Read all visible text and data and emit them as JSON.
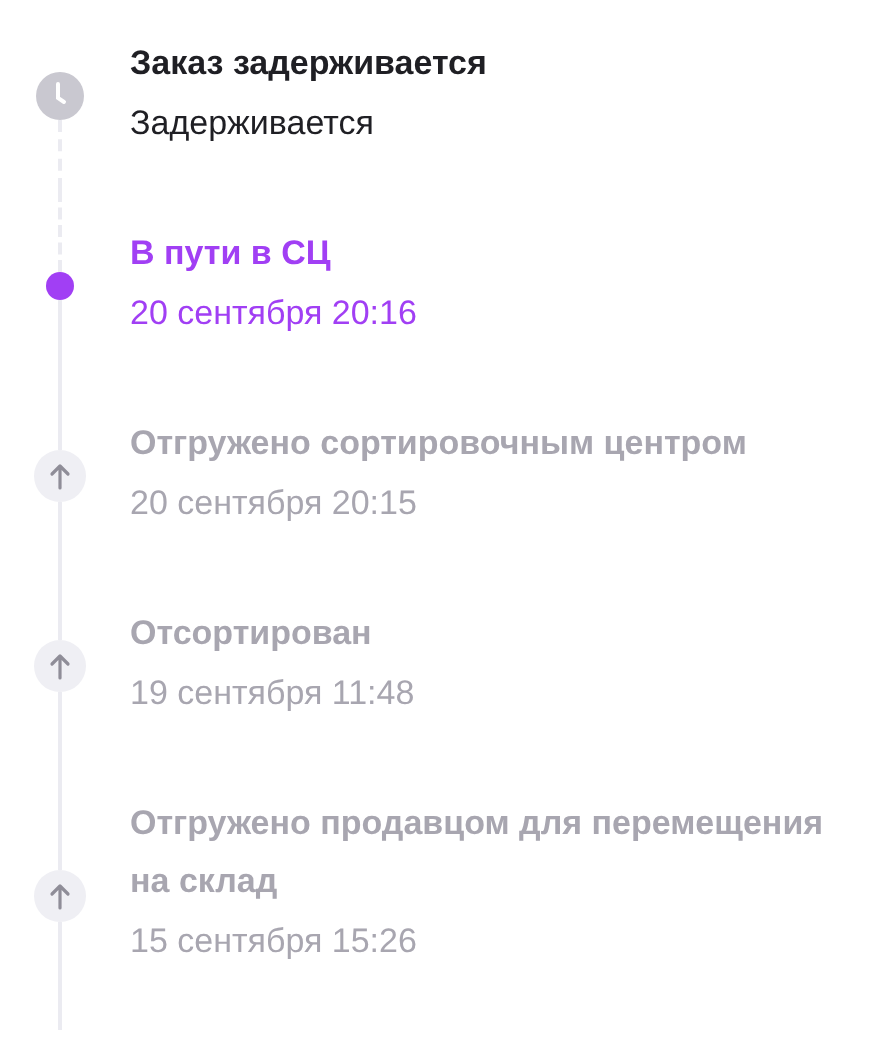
{
  "timeline": [
    {
      "kind": "delayed",
      "title": "Заказ задерживается",
      "subtitle": "Задерживается"
    },
    {
      "kind": "current",
      "title": "В пути в СЦ",
      "subtitle": "20 сентября 20:16"
    },
    {
      "kind": "done",
      "title": "Отгружено сортировочным центром",
      "subtitle": "20 сентября 20:15"
    },
    {
      "kind": "done",
      "title": "Отсортирован",
      "subtitle": "19 сентября 11:48"
    },
    {
      "kind": "done",
      "title": "Отгружено продавцом для перемещения на склад",
      "subtitle": "15 сентября 15:26"
    }
  ]
}
